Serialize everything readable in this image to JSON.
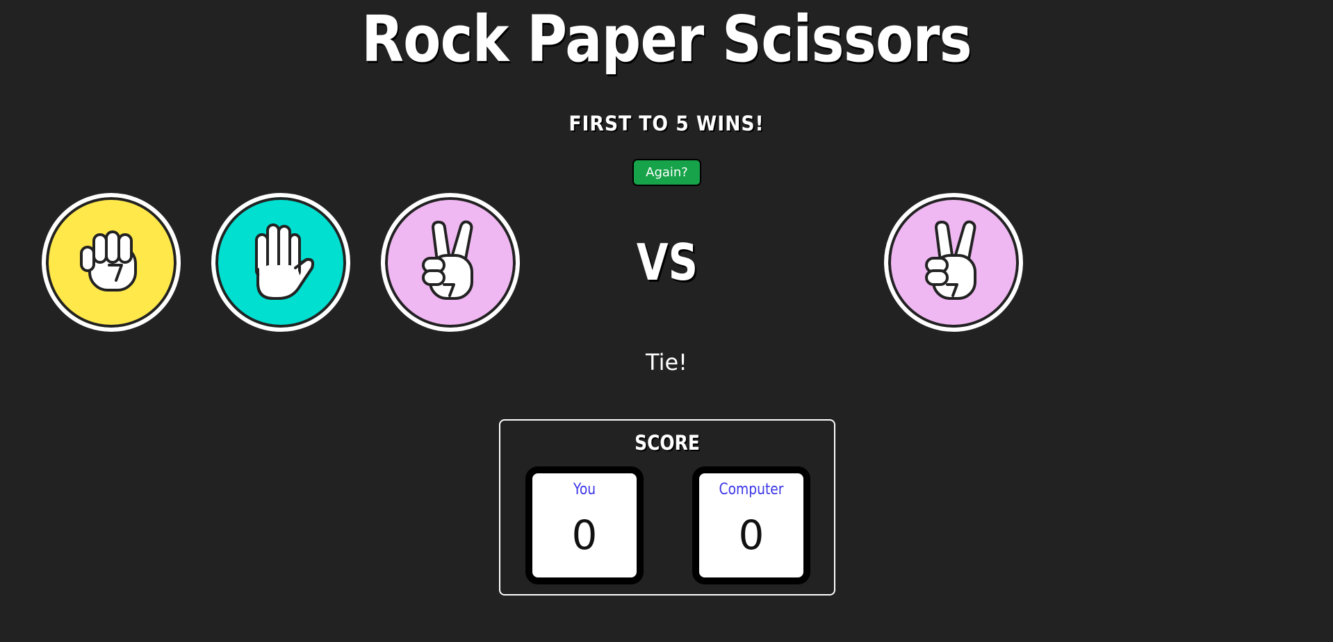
{
  "title": "Rock Paper Scissors",
  "subtitle": "FIRST TO 5 WINS!",
  "again_button": "Again?",
  "player_choices": [
    {
      "name": "rock",
      "icon": "fist-icon",
      "color": "#FFE94A"
    },
    {
      "name": "paper",
      "icon": "open-hand-icon",
      "color": "#00DFD0"
    },
    {
      "name": "scissors",
      "icon": "peace-sign-icon",
      "color": "#F0B8F2"
    }
  ],
  "vs_label": "VS",
  "computer_choice": {
    "name": "scissors",
    "icon": "peace-sign-icon",
    "color": "#F0B8F2"
  },
  "result": "Tie!",
  "score": {
    "title": "SCORE",
    "player_label": "You",
    "player_value": "0",
    "computer_label": "Computer",
    "computer_value": "0"
  },
  "colors": {
    "background": "#222222",
    "again_button": "#16A34A",
    "score_label": "#3B35E6"
  }
}
